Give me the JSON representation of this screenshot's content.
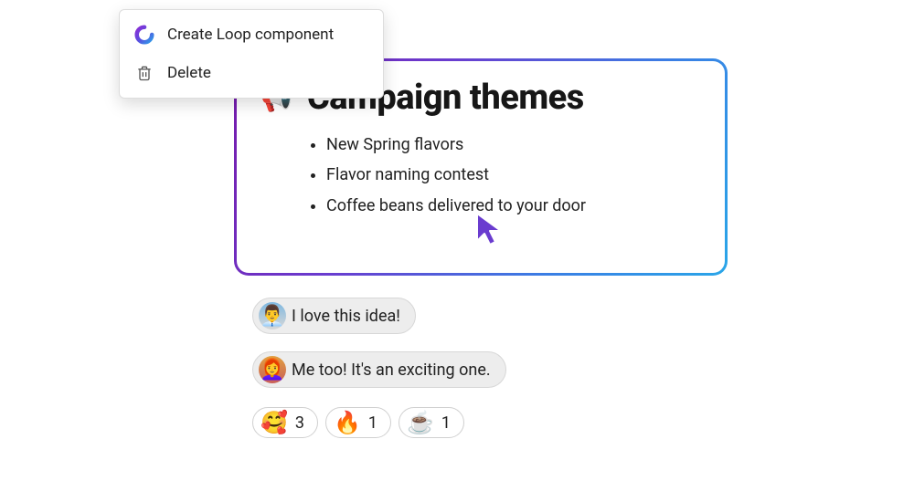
{
  "menu": {
    "create_loop": "Create Loop component",
    "delete": "Delete"
  },
  "card": {
    "title_emoji": "📢",
    "title": "Campaign themes",
    "items": [
      "New Spring flavors",
      "Flavor naming contest",
      "Coffee beans delivered to your door"
    ]
  },
  "replies": [
    {
      "avatar_emoji": "👨‍💼",
      "text": "I love this idea!"
    },
    {
      "avatar_emoji": "👩‍🦰",
      "text": "Me too! It's an exciting one."
    }
  ],
  "reactions": [
    {
      "emoji": "🥰",
      "count": "3"
    },
    {
      "emoji": "🔥",
      "count": "1"
    },
    {
      "emoji": "☕",
      "count": "1"
    }
  ]
}
